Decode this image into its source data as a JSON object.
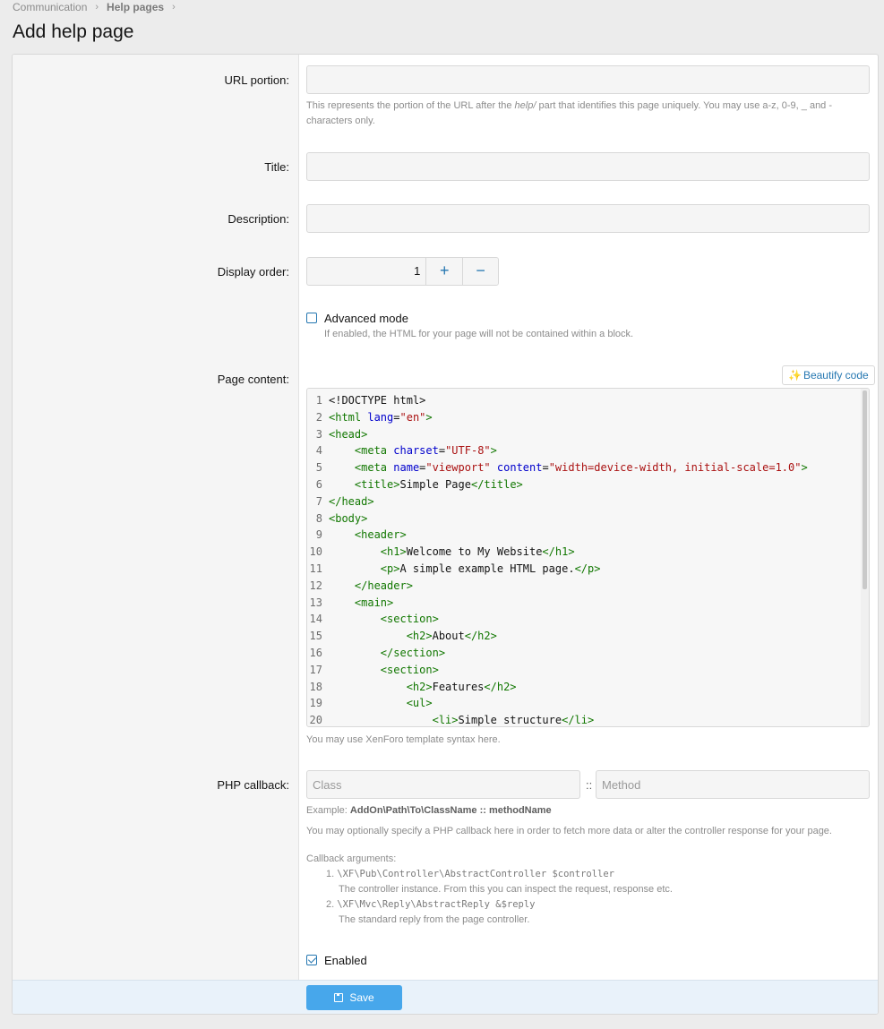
{
  "breadcrumb": {
    "items": [
      "Communication",
      "Help pages"
    ],
    "separator": "›"
  },
  "page_title": "Add help page",
  "form": {
    "url_portion": {
      "label": "URL portion:",
      "value": "",
      "hint_before": "This represents the portion of the URL after the ",
      "hint_em": "help/",
      "hint_after": " part that identifies this page uniquely. You may use a-z, 0-9, _ and -",
      "hint_line2": "characters only."
    },
    "title": {
      "label": "Title:",
      "value": ""
    },
    "description": {
      "label": "Description:",
      "value": ""
    },
    "display_order": {
      "label": "Display order:",
      "value": "1",
      "plus": "+",
      "minus": "−"
    },
    "advanced_mode": {
      "label": "Advanced mode",
      "checked": false,
      "hint": "If enabled, the HTML for your page will not be contained within a block."
    },
    "page_content": {
      "label": "Page content:",
      "beautify_label": "Beautify code",
      "hint": "You may use XenForo template syntax here."
    },
    "php_callback": {
      "label": "PHP callback:",
      "class_placeholder": "Class",
      "method_placeholder": "Method",
      "separator": "::",
      "example_prefix": "Example: ",
      "example_value": "AddOn\\Path\\To\\ClassName :: methodName",
      "description": "You may optionally specify a PHP callback here in order to fetch more data or alter the controller response for your page.",
      "args_title": "Callback arguments:",
      "args": [
        {
          "num": "1.",
          "code": "\\XF\\Pub\\Controller\\AbstractController $controller",
          "desc": "The controller instance. From this you can inspect the request, response etc."
        },
        {
          "num": "2.",
          "code": "\\XF\\Mvc\\Reply\\AbstractReply &$reply",
          "desc": "The standard reply from the page controller."
        }
      ]
    },
    "enabled": {
      "label": "Enabled",
      "checked": true
    },
    "save_label": "Save"
  },
  "code_lines": [
    [
      [
        "tk-txt",
        "<!DOCTYPE html>"
      ]
    ],
    [
      [
        "tk-tag",
        "<html "
      ],
      [
        "tk-attr",
        "lang"
      ],
      [
        "tk-txt",
        "="
      ],
      [
        "tk-str",
        "\"en\""
      ],
      [
        "tk-tag",
        ">"
      ]
    ],
    [
      [
        "tk-tag",
        "<head>"
      ]
    ],
    [
      [
        "tk-txt",
        "    "
      ],
      [
        "tk-tag",
        "<meta "
      ],
      [
        "tk-attr",
        "charset"
      ],
      [
        "tk-txt",
        "="
      ],
      [
        "tk-str",
        "\"UTF-8\""
      ],
      [
        "tk-tag",
        ">"
      ]
    ],
    [
      [
        "tk-txt",
        "    "
      ],
      [
        "tk-tag",
        "<meta "
      ],
      [
        "tk-attr",
        "name"
      ],
      [
        "tk-txt",
        "="
      ],
      [
        "tk-str",
        "\"viewport\""
      ],
      [
        "tk-txt",
        " "
      ],
      [
        "tk-attr",
        "content"
      ],
      [
        "tk-txt",
        "="
      ],
      [
        "tk-str",
        "\"width=device-width, initial-scale=1.0\""
      ],
      [
        "tk-tag",
        ">"
      ]
    ],
    [
      [
        "tk-txt",
        "    "
      ],
      [
        "tk-tag",
        "<title>"
      ],
      [
        "tk-txt",
        "Simple Page"
      ],
      [
        "tk-tag",
        "</title>"
      ]
    ],
    [
      [
        "tk-tag",
        "</head>"
      ]
    ],
    [
      [
        "tk-tag",
        "<body>"
      ]
    ],
    [
      [
        "tk-txt",
        "    "
      ],
      [
        "tk-tag",
        "<header>"
      ]
    ],
    [
      [
        "tk-txt",
        "        "
      ],
      [
        "tk-tag",
        "<h1>"
      ],
      [
        "tk-txt",
        "Welcome to My Website"
      ],
      [
        "tk-tag",
        "</h1>"
      ]
    ],
    [
      [
        "tk-txt",
        "        "
      ],
      [
        "tk-tag",
        "<p>"
      ],
      [
        "tk-txt",
        "A simple example HTML page."
      ],
      [
        "tk-tag",
        "</p>"
      ]
    ],
    [
      [
        "tk-txt",
        "    "
      ],
      [
        "tk-tag",
        "</header>"
      ]
    ],
    [
      [
        "tk-txt",
        "    "
      ],
      [
        "tk-tag",
        "<main>"
      ]
    ],
    [
      [
        "tk-txt",
        "        "
      ],
      [
        "tk-tag",
        "<section>"
      ]
    ],
    [
      [
        "tk-txt",
        "            "
      ],
      [
        "tk-tag",
        "<h2>"
      ],
      [
        "tk-txt",
        "About"
      ],
      [
        "tk-tag",
        "</h2>"
      ]
    ],
    [
      [
        "tk-txt",
        "        "
      ],
      [
        "tk-tag",
        "</section>"
      ]
    ],
    [
      [
        "tk-txt",
        "        "
      ],
      [
        "tk-tag",
        "<section>"
      ]
    ],
    [
      [
        "tk-txt",
        "            "
      ],
      [
        "tk-tag",
        "<h2>"
      ],
      [
        "tk-txt",
        "Features"
      ],
      [
        "tk-tag",
        "</h2>"
      ]
    ],
    [
      [
        "tk-txt",
        "            "
      ],
      [
        "tk-tag",
        "<ul>"
      ]
    ],
    [
      [
        "tk-txt",
        "                "
      ],
      [
        "tk-tag",
        "<li>"
      ],
      [
        "tk-txt",
        "Simple structure"
      ],
      [
        "tk-tag",
        "</li>"
      ]
    ]
  ],
  "colors": {
    "accent": "#2577b1",
    "save_button": "#47a7eb",
    "footer": "#e9f2fa"
  }
}
